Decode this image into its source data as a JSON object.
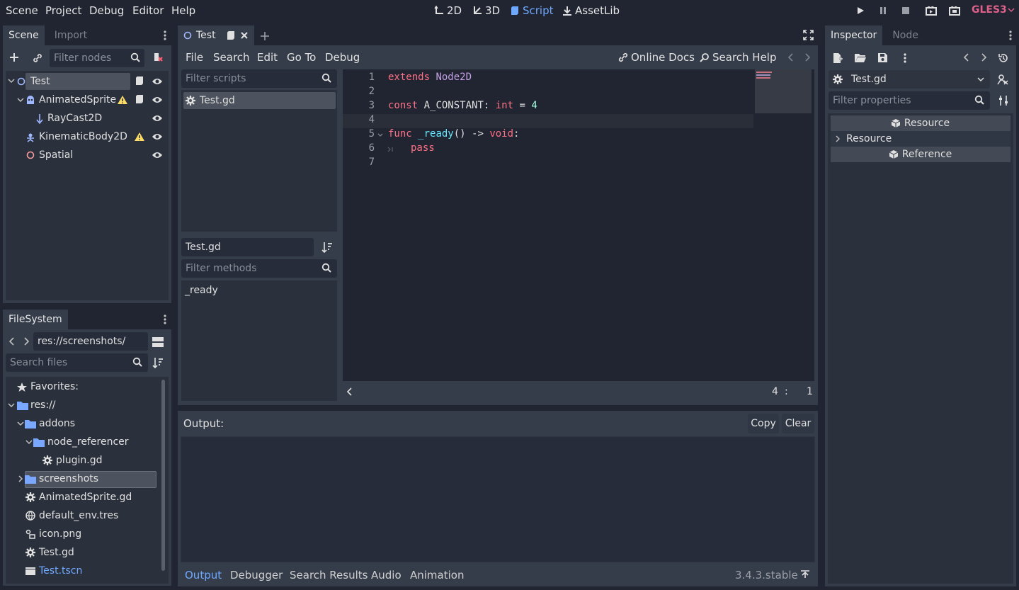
{
  "menu": {
    "scene": "Scene",
    "project": "Project",
    "debug": "Debug",
    "editor": "Editor",
    "help": "Help"
  },
  "modes": {
    "m2d": "2D",
    "m3d": "3D",
    "script": "Script",
    "assetlib": "AssetLib"
  },
  "renderer": "GLES3",
  "scene_dock": {
    "tabs": [
      "Scene",
      "Import"
    ],
    "filter_placeholder": "Filter nodes",
    "nodes": [
      {
        "label": "Test"
      },
      {
        "label": "AnimatedSprite"
      },
      {
        "label": "RayCast2D"
      },
      {
        "label": "KinematicBody2D"
      },
      {
        "label": "Spatial"
      }
    ]
  },
  "filesystem": {
    "tab": "FileSystem",
    "path": "res://screenshots/",
    "search_placeholder": "Search files",
    "items": [
      {
        "label": "Favorites:"
      },
      {
        "label": "res://"
      },
      {
        "label": "addons"
      },
      {
        "label": "node_referencer"
      },
      {
        "label": "plugin.gd"
      },
      {
        "label": "screenshots"
      },
      {
        "label": "AnimatedSprite.gd"
      },
      {
        "label": "default_env.tres"
      },
      {
        "label": "icon.png"
      },
      {
        "label": "Test.gd"
      },
      {
        "label": "Test.tscn"
      }
    ]
  },
  "script_editor": {
    "tab": "Test",
    "menus": {
      "file": "File",
      "search": "Search",
      "edit": "Edit",
      "goto": "Go To",
      "debug": "Debug"
    },
    "online_docs": "Online Docs",
    "search_help": "Search Help",
    "filter_scripts_placeholder": "Filter scripts",
    "scripts": [
      "Test.gd"
    ],
    "current_script": "Test.gd",
    "filter_methods_placeholder": "Filter methods",
    "methods": [
      "_ready"
    ],
    "line_numbers": [
      "1",
      "2",
      "3",
      "4",
      "5",
      "6",
      "7"
    ],
    "cursor": {
      "line": "4",
      "sep": ":",
      "col": "1"
    },
    "code": {
      "l1a": "extends",
      "l1b": "Node2D",
      "l3a": "const",
      "l3b": "A_CONSTANT:",
      "l3c": "int",
      "l3d": "=",
      "l3e": "4",
      "l5a": "func",
      "l5b": "_ready",
      "l5c": "()",
      "l5d": "->",
      "l5e": "void",
      "l5f": ":",
      "l6": "pass"
    }
  },
  "output": {
    "label": "Output:",
    "copy": "Copy",
    "clear": "Clear",
    "tabs": [
      "Output",
      "Debugger",
      "Search Results",
      "Audio",
      "Animation"
    ],
    "version": "3.4.3.stable"
  },
  "inspector": {
    "tabs": [
      "Inspector",
      "Node"
    ],
    "resource_name": "Test.gd",
    "filter_placeholder": "Filter properties",
    "sections": {
      "resource_header": "Resource",
      "resource_group": "Resource",
      "reference_header": "Reference"
    }
  }
}
